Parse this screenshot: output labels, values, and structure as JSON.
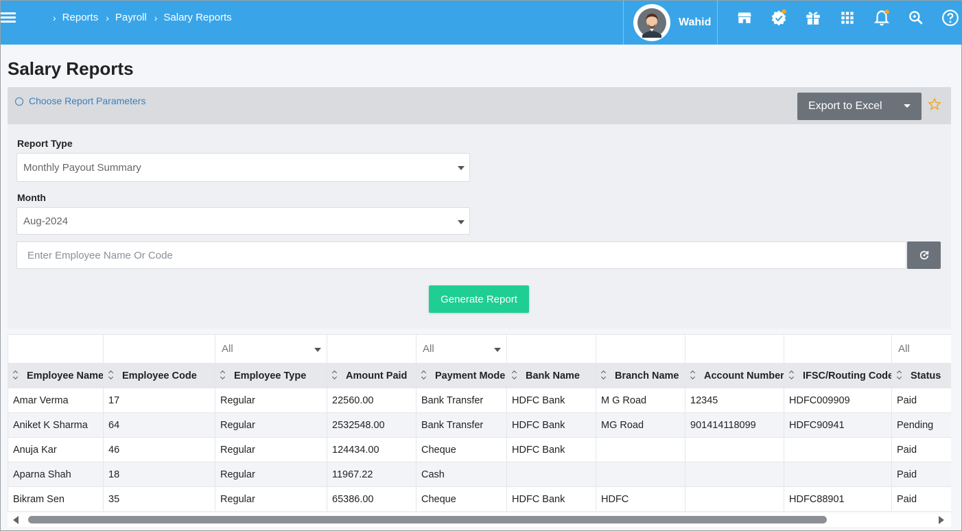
{
  "header": {
    "breadcrumb": [
      "Reports",
      "Payroll",
      "Salary Reports"
    ],
    "user_name": "Wahid",
    "icons": [
      "store-icon",
      "verified-badge-icon",
      "gift-icon",
      "apps-grid-icon",
      "bell-icon",
      "search-icon",
      "help-icon"
    ],
    "accent_color": "#39a5e8"
  },
  "page": {
    "title": "Salary Reports",
    "params_link": "Choose Report Parameters",
    "export_label": "Export to Excel"
  },
  "form": {
    "report_type_label": "Report Type",
    "report_type_value": "Monthly Payout Summary",
    "month_label": "Month",
    "month_value": "Aug-2024",
    "search_placeholder": "Enter Employee Name Or Code",
    "generate_label": "Generate Report",
    "generate_color": "#1fce92"
  },
  "grid": {
    "filters": {
      "employee_type": "All",
      "payment_mode": "All",
      "status": "All"
    },
    "columns": [
      "Employee Name",
      "Employee Code",
      "Employee Type",
      "Amount Paid",
      "Payment Mode",
      "Bank Name",
      "Branch Name",
      "Account Number",
      "IFSC/Routing Code",
      "Status"
    ],
    "rows": [
      [
        "Amar Verma",
        "17",
        "Regular",
        "22560.00",
        "Bank Transfer",
        "HDFC Bank",
        "M G Road",
        "12345",
        "HDFC009909",
        "Paid"
      ],
      [
        "Aniket K Sharma",
        "64",
        "Regular",
        "2532548.00",
        "Bank Transfer",
        "HDFC Bank",
        "MG Road",
        "901414118099",
        "HDFC90941",
        "Pending"
      ],
      [
        "Anuja Kar",
        "46",
        "Regular",
        "124434.00",
        "Cheque",
        "HDFC Bank",
        "",
        "",
        "",
        "Paid"
      ],
      [
        "Aparna Shah",
        "18",
        "Regular",
        "11967.22",
        "Cash",
        "",
        "",
        "",
        "",
        "Paid"
      ],
      [
        "Bikram Sen",
        "35",
        "Regular",
        "65386.00",
        "Cheque",
        "HDFC Bank",
        "HDFC",
        "",
        "HDFC88901",
        "Paid"
      ]
    ]
  }
}
